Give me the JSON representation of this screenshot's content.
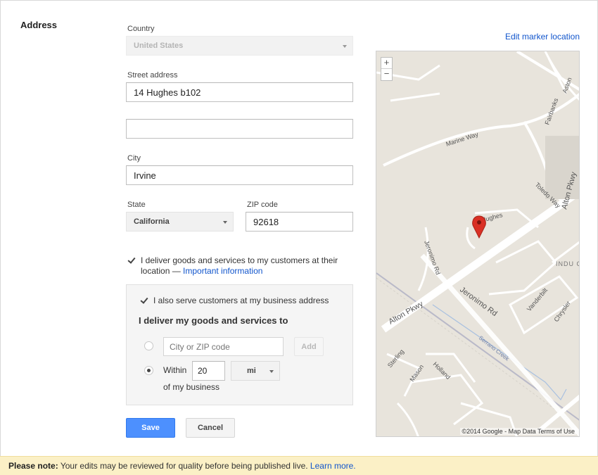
{
  "section": {
    "title": "Address"
  },
  "country": {
    "label": "Country",
    "value": "United States"
  },
  "street": {
    "label": "Street address",
    "line1": "14 Hughes b102",
    "line2": ""
  },
  "city": {
    "label": "City",
    "value": "Irvine"
  },
  "state": {
    "label": "State",
    "value": "California"
  },
  "zip": {
    "label": "ZIP code",
    "value": "92618"
  },
  "deliver": {
    "checked": true,
    "text": "I deliver goods and services to my customers at their location — ",
    "link": "Important information"
  },
  "serve_box": {
    "also_serve_checked": true,
    "also_serve_label": "I also serve customers at my business address",
    "heading": "I deliver my goods and services to",
    "city_zip_placeholder": "City or ZIP code",
    "add_label": "Add",
    "within_label": "Within",
    "within_value": "20",
    "unit": "mi",
    "of_business": "of my business",
    "selected_option": "within"
  },
  "buttons": {
    "save": "Save",
    "cancel": "Cancel"
  },
  "map": {
    "edit_link": "Edit marker location",
    "zoom_in": "+",
    "zoom_out": "−",
    "footer": "©2014 Google - Map Data   Terms of Use",
    "streets": [
      "Alton Pkwy",
      "Jeronimo Rd",
      "Marine Way",
      "Toledo Way",
      "Hughes",
      "Serrano Creek",
      "Vanderbilt",
      "Chrysler",
      "Sterling",
      "Mason",
      "Holland",
      "Fairbanks",
      "Aston"
    ],
    "poi": "INDU COMP"
  },
  "note": {
    "prefix": "Please note:",
    "text": " Your edits may be reviewed for quality before being published live. ",
    "link": "Learn more."
  },
  "colors": {
    "primary": "#4d90fe",
    "link": "#1155cc",
    "note_bg": "#fbf0c6",
    "map_bg": "#e8e4dc",
    "marker": "#d93025"
  }
}
